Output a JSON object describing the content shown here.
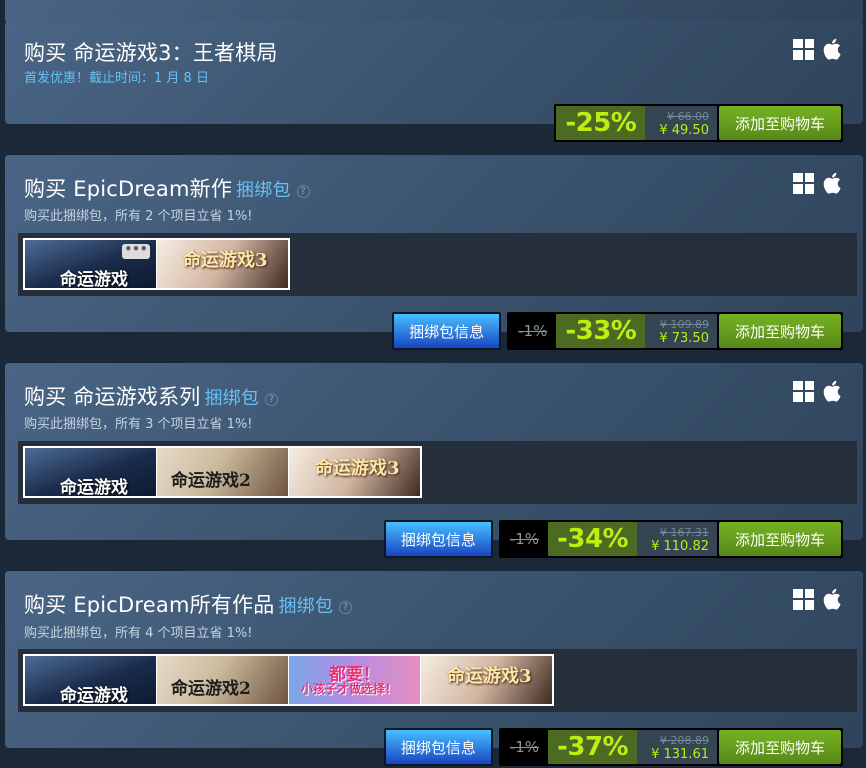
{
  "platform_icons": [
    "windows-icon",
    "apple-icon"
  ],
  "colors": {
    "background": "#1b2838",
    "accent_blue": "#67c1f5",
    "discount_green": "#beee11",
    "cart_green": "#75b022",
    "info_blue": "#47bfff"
  },
  "purchase_block": {
    "title": "购买 命运游戏3：王者棋局",
    "promo": "首发优惠！截止时间：1 月 8 日",
    "discount": "-25%",
    "original_price": "¥ 66.00",
    "final_price": "¥ 49.50",
    "cart_label": "添加至购物车"
  },
  "bundles": [
    {
      "title": "购买 EpicDream新作",
      "bundle_word": "捆绑包",
      "help": "?",
      "subtitle": "购买此捆绑包，所有 2 个项目立省 1%!",
      "thumbs": [
        {
          "name": "命运游戏",
          "sub": "",
          "art": "thumb-g1"
        },
        {
          "name": "命运游戏3",
          "sub": "",
          "art": "thumb-g3"
        }
      ],
      "more_indicator": "•••",
      "info_label": "捆绑包信息",
      "bundle_pct": "-1%",
      "discount": "-33%",
      "original_price": "¥ 109.89",
      "final_price": "¥ 73.50",
      "cart_label": "添加至购物车"
    },
    {
      "title": "购买 命运游戏系列",
      "bundle_word": "捆绑包",
      "help": "?",
      "subtitle": "购买此捆绑包，所有 3 个项目立省 1%!",
      "thumbs": [
        {
          "name": "命运游戏",
          "sub": "",
          "art": "thumb-g1"
        },
        {
          "name": "命运游戏2",
          "sub": "",
          "art": "thumb-g2"
        },
        {
          "name": "命运游戏3",
          "sub": "",
          "art": "thumb-g3"
        }
      ],
      "info_label": "捆绑包信息",
      "bundle_pct": "-1%",
      "discount": "-34%",
      "original_price": "¥ 167.31",
      "final_price": "¥ 110.82",
      "cart_label": "添加至购物车"
    },
    {
      "title": "购买 EpicDream所有作品",
      "bundle_word": "捆绑包",
      "help": "?",
      "subtitle": "购买此捆绑包，所有 4 个项目立省 1%!",
      "thumbs": [
        {
          "name": "命运游戏",
          "sub": "",
          "art": "thumb-g1"
        },
        {
          "name": "命运游戏2",
          "sub": "",
          "art": "thumb-g2"
        },
        {
          "name": "都要！",
          "sub": "小孩子才做选择！",
          "art": "thumb-g4"
        },
        {
          "name": "命运游戏3",
          "sub": "",
          "art": "thumb-g3"
        }
      ],
      "info_label": "捆绑包信息",
      "bundle_pct": "-1%",
      "discount": "-37%",
      "original_price": "¥ 208.89",
      "final_price": "¥ 131.61",
      "cart_label": "添加至购物车"
    }
  ]
}
